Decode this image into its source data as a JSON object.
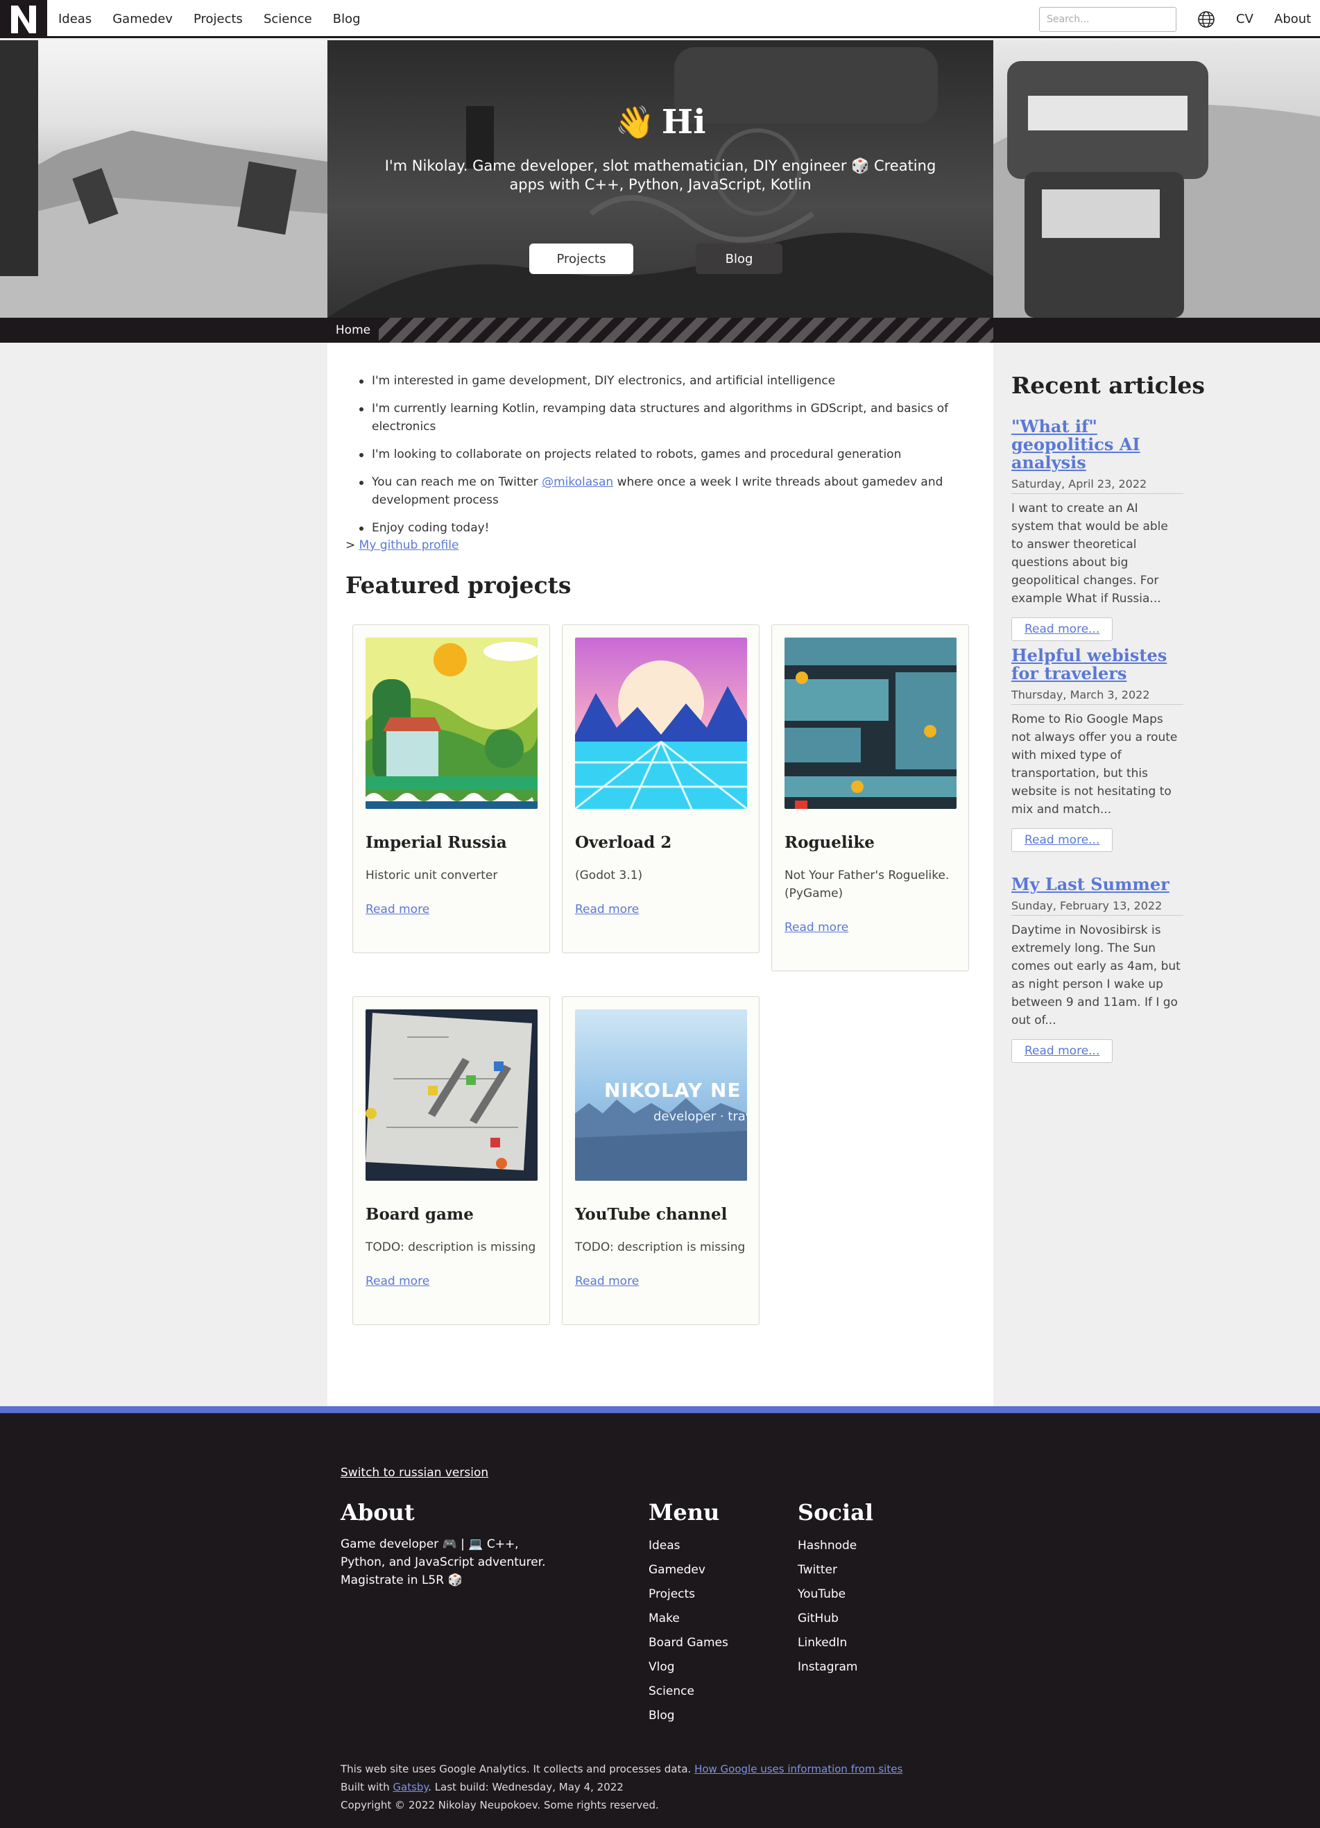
{
  "nav": {
    "logo_letter": "N",
    "links": [
      "Ideas",
      "Gamedev",
      "Projects",
      "Science",
      "Blog"
    ],
    "search_placeholder": "Search...",
    "cv": "CV",
    "about": "About"
  },
  "hero": {
    "emoji": "👋",
    "title": "Hi",
    "subtitle": "I'm Nikolay. Game developer, slot mathematician, DIY engineer 🎲 Creating apps with C++, Python, JavaScript, Kotlin",
    "btn_projects": "Projects",
    "btn_blog": "Blog"
  },
  "breadcrumb": "Home",
  "intro": {
    "bullets": [
      "I'm interested in game development, DIY electronics, and artificial intelligence",
      "I'm currently learning Kotlin, revamping data structures and algorithms in GDScript, and basics of electronics",
      "I'm looking to collaborate on projects related to robots, games and procedural generation"
    ],
    "twitter_before": "You can reach me on Twitter ",
    "twitter_handle": "@mikolasan",
    "twitter_after": " where once a week I write threads about gamedev and development process",
    "last_bullet": "Enjoy coding today!",
    "github_prefix": "> ",
    "github_link": "My github profile"
  },
  "featured": {
    "title": "Featured projects",
    "read_more": "Read more",
    "cards": [
      {
        "title": "Imperial Russia",
        "desc": "Historic unit converter"
      },
      {
        "title": "Overload 2",
        "desc": "(Godot 3.1)"
      },
      {
        "title": "Roguelike",
        "desc": "Not Your Father's Roguelike. (PyGame)"
      },
      {
        "title": "Board game",
        "desc": "TODO: description is missing"
      },
      {
        "title": "YouTube channel",
        "desc": "TODO: description is missing"
      }
    ],
    "youtube_thumb_name": "NIKOLAY NE",
    "youtube_thumb_sub": "developer · trave"
  },
  "sidebar": {
    "title": "Recent articles",
    "btn": "Read more...",
    "articles": [
      {
        "title": "\"What if\" geopolitics AI analysis",
        "date": "Saturday, April 23, 2022",
        "text": "I want to create an AI system that would be able to answer theoretical questions about big geopolitical changes. For example What if Russia..."
      },
      {
        "title": "Helpful webistes for travelers",
        "date": "Thursday, March 3, 2022",
        "text": "Rome to Rio Google Maps not always offer you a route with mixed type of transportation, but this website is not hesitating to mix and match..."
      },
      {
        "title": "My Last Summer",
        "date": "Sunday, February 13, 2022",
        "text": "Daytime in Novosibirsk is extremely long. The Sun comes out early as 4am, but as night person I wake up between 9 and 11am. If I go out of..."
      }
    ]
  },
  "footer": {
    "switch": "Switch to russian version",
    "about_title": "About",
    "about_text": "Game developer 🎮 | 💻 C++, Python, and JavaScript adventurer. Magistrate in L5R 🎲",
    "menu_title": "Menu",
    "menu": [
      "Ideas",
      "Gamedev",
      "Projects",
      "Make",
      "Board Games",
      "Vlog",
      "Science",
      "Blog"
    ],
    "social_title": "Social",
    "social": [
      "Hashnode",
      "Twitter",
      "YouTube",
      "GitHub",
      "LinkedIn",
      "Instagram"
    ],
    "analytics_text": "This web site uses Google Analytics. It collects and processes data. ",
    "analytics_link": "How Google uses information from sites",
    "built_prefix": "Built with ",
    "built_link": "Gatsby",
    "built_suffix": ". Last build: Wednesday, May 4, 2022",
    "copyright": "Copyright © 2022 Nikolay Neupokoev. Some rights reserved."
  },
  "colors": {
    "dark": "#1d181b",
    "accent": "#5a78d6",
    "footer_stripe": "#5a6fd0",
    "card_bg": "#fcfcf8"
  }
}
